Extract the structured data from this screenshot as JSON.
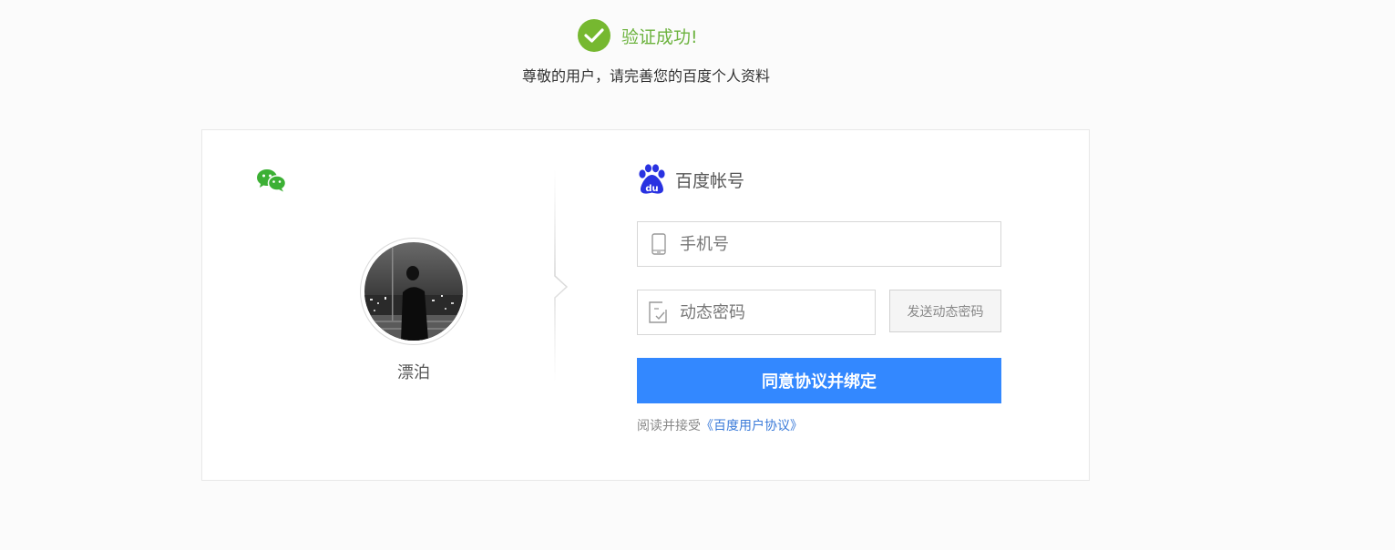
{
  "header": {
    "status_text": "验证成功!",
    "subtitle": "尊敬的用户，请完善您的百度个人资料"
  },
  "wechat": {
    "icon": "wechat-icon",
    "nickname": "漂泊"
  },
  "baidu": {
    "icon": "baidu-paw-icon",
    "title": "百度帐号",
    "phone_placeholder": "手机号",
    "code_placeholder": "动态密码",
    "send_code_label": "发送动态密码",
    "submit_label": "同意协议并绑定",
    "agreement_prefix": "阅读并接受",
    "agreement_link": "《百度用户协议》"
  },
  "colors": {
    "success": "#76b830",
    "primary": "#3388ff",
    "link": "#3a7ad9",
    "baidu_blue": "#2932e1"
  }
}
